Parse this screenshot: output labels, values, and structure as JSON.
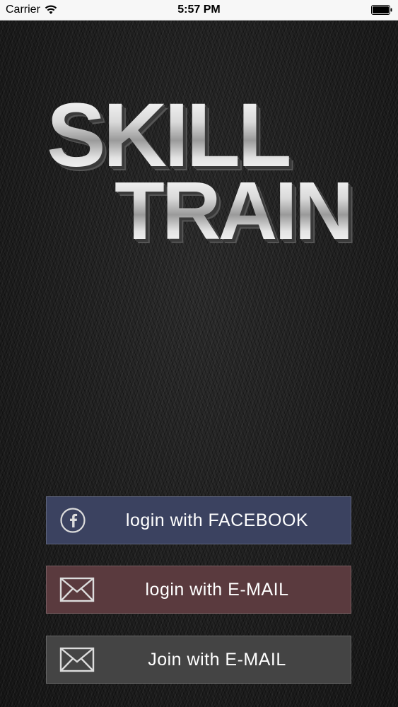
{
  "status_bar": {
    "carrier": "Carrier",
    "time": "5:57 PM",
    "icons": [
      "wifi-icon",
      "battery-icon"
    ]
  },
  "logo": {
    "line1": "SKILL",
    "line2": "TRAIN"
  },
  "buttons": {
    "facebook": {
      "label": "login with FACEBOOK",
      "icon": "facebook-icon",
      "color": "#3b4260"
    },
    "email_login": {
      "label": "login with E-MAIL",
      "icon": "mail-icon",
      "color": "#5a3a3e"
    },
    "email_join": {
      "label": "Join with E-MAIL",
      "icon": "mail-icon",
      "color": "#444444"
    }
  }
}
